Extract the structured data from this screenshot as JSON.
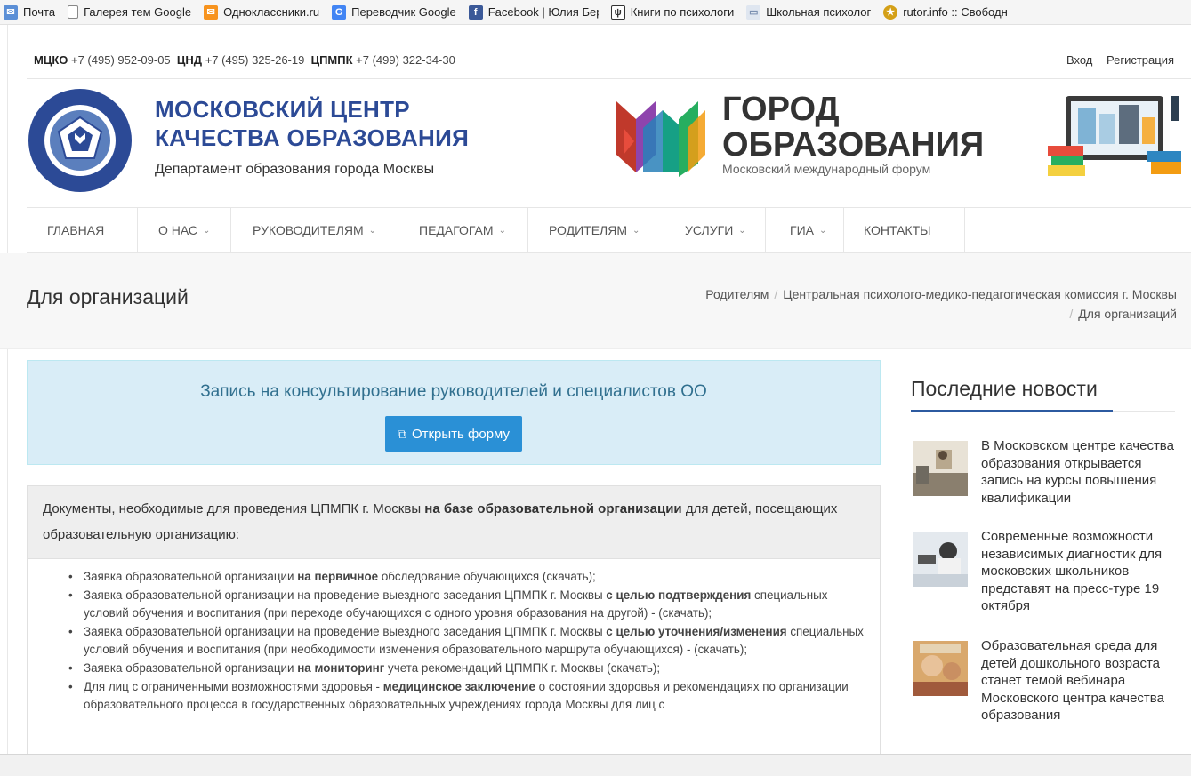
{
  "bookmarks": [
    {
      "label": "Почта",
      "icon": "mail-icon",
      "color": "#5b8fd6"
    },
    {
      "label": "Галерея тем Google",
      "icon": "page-icon",
      "color": "#777777"
    },
    {
      "label": "Одноклассники.ru",
      "icon": "ok-icon",
      "color": "#f7931e"
    },
    {
      "label": "Переводчик Google",
      "icon": "translate-icon",
      "color": "#4285f4"
    },
    {
      "label": "Facebook | Юлия Бер",
      "icon": "facebook-icon",
      "color": "#3b5998"
    },
    {
      "label": "Книги по психологи",
      "icon": "book-icon",
      "color": "#444444"
    },
    {
      "label": "Школьная психолог",
      "icon": "monitor-icon",
      "color": "#7a8fb0"
    },
    {
      "label": "rutor.info :: Свободн",
      "icon": "rutor-icon",
      "color": "#d4a017"
    }
  ],
  "topbar": {
    "contacts": [
      {
        "org": "МЦКО",
        "phone": "+7 (495) 952-09-05"
      },
      {
        "org": "ЦНД",
        "phone": "+7 (495) 325-26-19"
      },
      {
        "org": "ЦПМПК",
        "phone": "+7 (499) 322-34-30"
      }
    ],
    "login": "Вход",
    "register": "Регистрация"
  },
  "header": {
    "mcko_title_line1": "МОСКОВСКИЙ ЦЕНТР",
    "mcko_title_line2": "КАЧЕСТВА ОБРАЗОВАНИЯ",
    "mcko_subtitle": "Департамент образования города Москвы",
    "forum_line1": "ГОРОД",
    "forum_line2": "ОБРАЗОВАНИЯ",
    "forum_sub": "Московский международный форум",
    "brand_color": "#2c4a96"
  },
  "nav": [
    {
      "label": "ГЛАВНАЯ",
      "dropdown": false
    },
    {
      "label": "О НАС",
      "dropdown": true
    },
    {
      "label": "РУКОВОДИТЕЛЯМ",
      "dropdown": true
    },
    {
      "label": "ПЕДАГОГАМ",
      "dropdown": true
    },
    {
      "label": "РОДИТЕЛЯМ",
      "dropdown": true
    },
    {
      "label": "УСЛУГИ",
      "dropdown": true
    },
    {
      "label": "ГИА",
      "dropdown": true
    },
    {
      "label": "КОНТАКТЫ",
      "dropdown": false
    }
  ],
  "page": {
    "title": "Для организаций",
    "breadcrumb": [
      "Родителям",
      "Центральная психолого-медико-педагогическая комиссия г. Москвы",
      "Для организаций"
    ]
  },
  "callout": {
    "title": "Запись на консультирование руководителей и специалистов ОО",
    "button": "Открыть форму",
    "bg_color": "#d9edf7",
    "button_color": "#2a90d6"
  },
  "documents": {
    "intro_a": "Документы, необходимые для проведения ЦПМПК г. Москвы ",
    "intro_bold": "на базе образовательной организации",
    "intro_b": " для детей, посещающих образовательную организацию:",
    "items": [
      {
        "a": "Заявка образовательной организации ",
        "b": "на первичное",
        "c": " обследование обучающихся (скачать);"
      },
      {
        "a": "Заявка образовательной организации на проведение выездного заседания ЦПМПК г. Москвы ",
        "b": "с целью подтверждения",
        "c": " специальных условий обучения и воспитания (при переходе обучающихся с одного уровня образования на другой) - (скачать);"
      },
      {
        "a": "Заявка образовательной организации на проведение выездного заседания ЦПМПК г. Москвы ",
        "b": "с целью уточнения/изменения",
        "c": " специальных условий обучения и воспитания (при необходимости изменения образовательного маршрута обучающихся) - (скачать);"
      },
      {
        "a": "Заявка образовательной организации ",
        "b": "на мониторинг",
        "c": " учета рекомендаций ЦПМПК г. Москвы (скачать);"
      },
      {
        "a": "Для лиц с ограниченными возможностями здоровья - ",
        "b": "медицинское заключение",
        "c": " о состоянии здоровья и рекомендациях по организации образовательного процесса в государственных образовательных учреждениях города Москвы для лиц с"
      }
    ]
  },
  "news": {
    "heading": "Последние новости",
    "items": [
      {
        "text": "В Московском центре качества образования открывается запись на курсы повышения квалификации"
      },
      {
        "text": "Современные возможности независимых диагностик для московских школьников представят на пресс-туре 19 октября"
      },
      {
        "text": "Образовательная среда для детей дошкольного возраста станет темой вебинара Московского центра качества образования"
      }
    ]
  }
}
